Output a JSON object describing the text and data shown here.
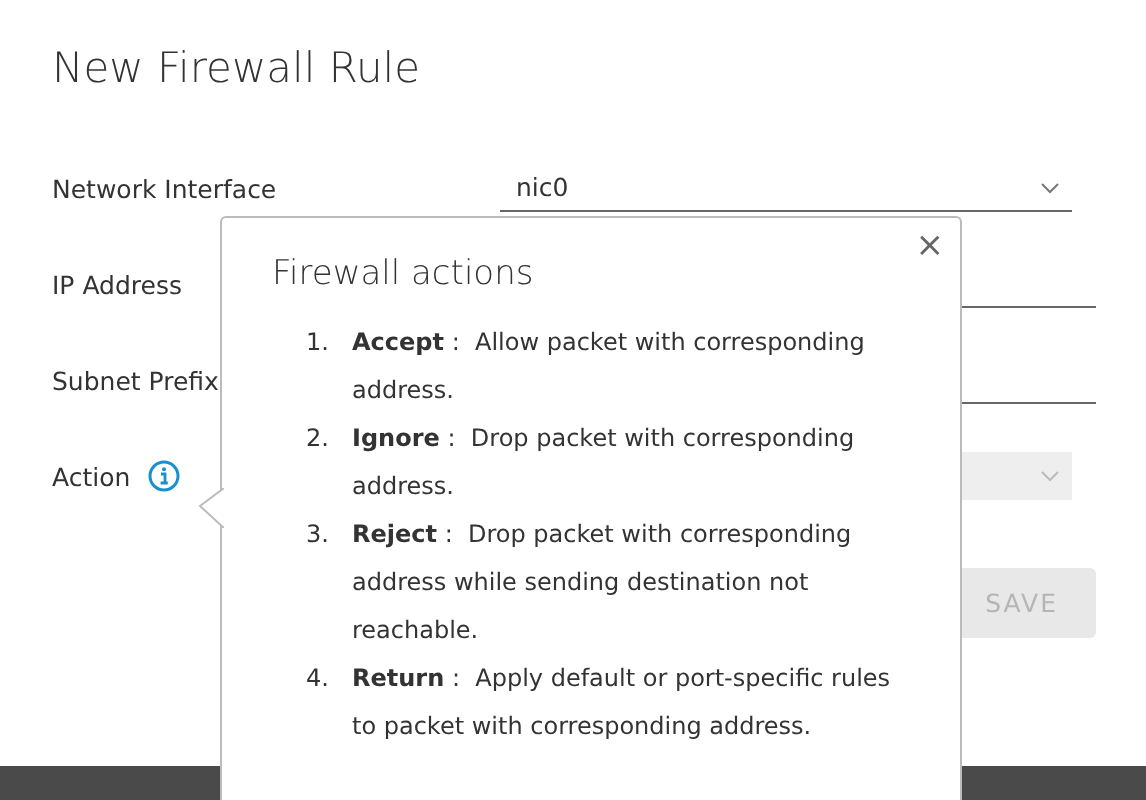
{
  "dialog": {
    "title": "New Firewall Rule",
    "fields": [
      {
        "label": "Network Interface",
        "kind": "select",
        "value": "nic0",
        "disabled": false
      },
      {
        "label": "IP Address",
        "kind": "input",
        "disabled": false
      },
      {
        "label": "Subnet Prefix",
        "kind": "input",
        "disabled": false
      },
      {
        "label": "Action",
        "kind": "select",
        "info": true,
        "disabled": true
      }
    ],
    "buttons": [
      {
        "label": "SAVE",
        "disabled": true
      }
    ]
  },
  "popover": {
    "title": "Firewall actions",
    "close": "×",
    "items": [
      {
        "number": "1.",
        "term": "Accept",
        "separator": ":",
        "text": "Allow packet with corresponding address."
      },
      {
        "number": "2.",
        "term": "Ignore",
        "separator": ":",
        "text": "Drop packet with corresponding address."
      },
      {
        "number": "3.",
        "term": "Reject",
        "separator": ":",
        "text": "Drop packet with corresponding address while sending destination not reachable."
      },
      {
        "number": "4.",
        "term": "Return",
        "separator": ":",
        "text": "Apply default or port-specific rules to packet with corresponding address."
      }
    ]
  }
}
